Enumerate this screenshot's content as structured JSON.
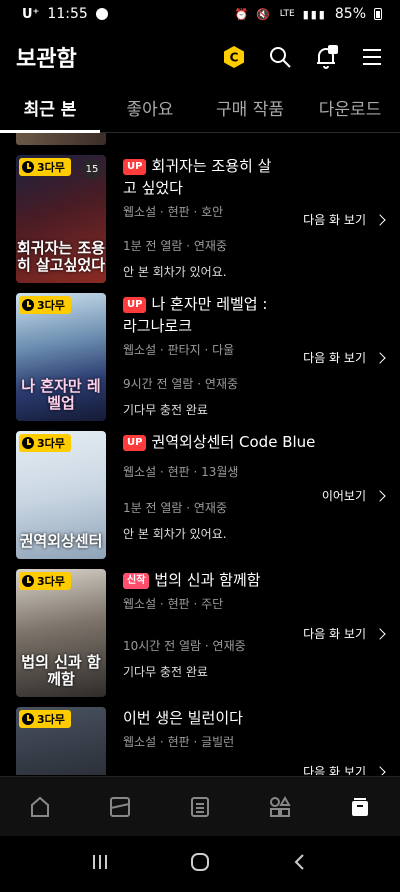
{
  "status": {
    "carrier": "U⁺",
    "time": "11:55",
    "battery": "85%",
    "signal_text": "LTE"
  },
  "header": {
    "title": "보관함"
  },
  "tabs": [
    {
      "label": "최근 본",
      "active": true
    },
    {
      "label": "좋아요",
      "active": false
    },
    {
      "label": "구매 작품",
      "active": false
    },
    {
      "label": "다운로드",
      "active": false
    }
  ],
  "items": [
    {
      "badge": "3다무",
      "age": "15",
      "tag": "UP",
      "title": "회귀자는 조용히 살고 싶었다",
      "cover_text": "회귀자는 조용히 살고싶었다",
      "genre": "웹소설 · 현판 · 호안",
      "meta": "1분 전 열람 · 연재중",
      "note": "안 본 회차가 있어요.",
      "action": "다음 화 보기"
    },
    {
      "badge": "3다무",
      "tag": "UP",
      "title": "나 혼자만 레벨업 : 라그나로크",
      "cover_text": "나 혼자만 레벨업",
      "genre": "웹소설 · 판타지 · 다울",
      "meta": "9시간 전 열람 · 연재중",
      "note": "기다무 충전 완료",
      "action": "다음 화 보기"
    },
    {
      "badge": "3다무",
      "tag": "UP",
      "title": "권역외상센터 Code Blue",
      "cover_text": "권역외상센터",
      "genre": "웹소설 · 현판 · 13월생",
      "meta": "1분 전 열람 · 연재중",
      "note": "안 본 회차가 있어요.",
      "action": "이어보기"
    },
    {
      "badge": "3다무",
      "tag": "신작",
      "title": "법의 신과 함께함",
      "cover_text": "법의 신과 함께함",
      "genre": "웹소설 · 현판 · 주단",
      "meta": "10시간 전 열람 · 연재중",
      "note": "기다무 충전 완료",
      "action": "다음 화 보기"
    },
    {
      "badge": "3다무",
      "tag": "",
      "title": "이번 생은 빌런이다",
      "cover_text": "",
      "genre": "웹소설 · 현판 · 글빌런",
      "meta": "",
      "note": "",
      "action": "다음 화 보기"
    }
  ],
  "bottom_nav": [
    "home-icon",
    "webtoon-icon",
    "novel-icon",
    "category-icon",
    "library-icon"
  ],
  "colors": {
    "accent": "#ffcc00",
    "up_tag": "#ff3b3b",
    "new_tag": "#ff4f6d"
  }
}
